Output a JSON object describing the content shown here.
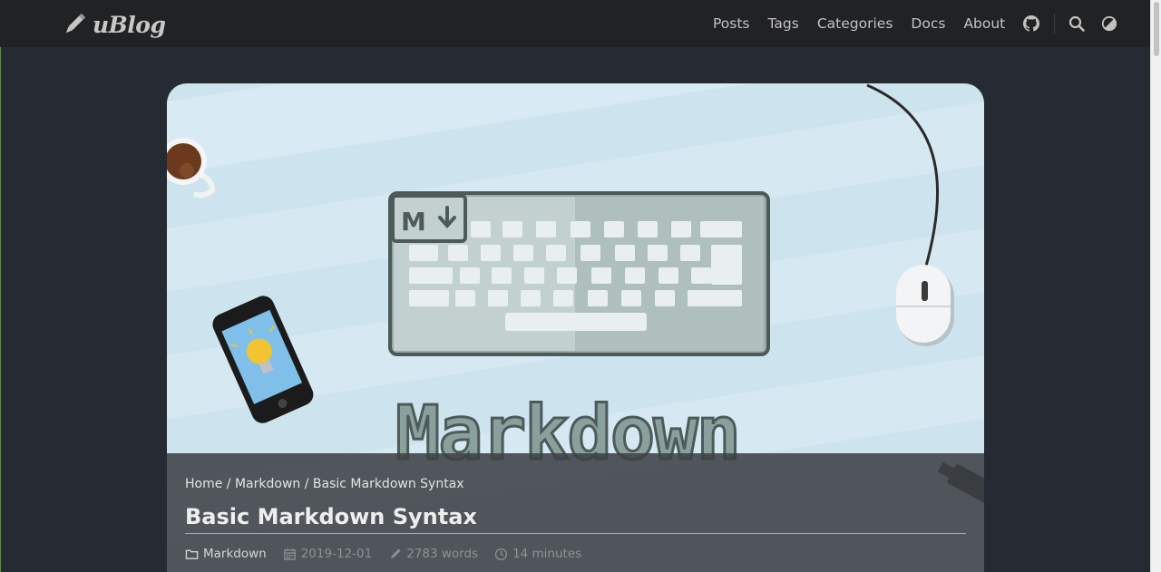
{
  "brand": {
    "name": "uBlog",
    "icon": "pencil-icon"
  },
  "nav": {
    "items": [
      {
        "label": "Posts"
      },
      {
        "label": "Tags"
      },
      {
        "label": "Categories"
      },
      {
        "label": "Docs"
      },
      {
        "label": "About"
      }
    ],
    "icons": [
      "github-icon",
      "search-icon",
      "theme-toggle-icon"
    ]
  },
  "hero": {
    "image_text": "Markdown",
    "badge_text": "M"
  },
  "post": {
    "breadcrumb": [
      "Home",
      "Markdown",
      "Basic Markdown Syntax"
    ],
    "breadcrumb_sep": " / ",
    "title": "Basic Markdown Syntax",
    "category": "Markdown",
    "date": "2019-12-01",
    "words": "2783 words",
    "reading_time": "14 minutes"
  },
  "colors": {
    "navbar": "#212224",
    "page_bg": "#262a33",
    "hero_bg": "#cde3ee"
  }
}
